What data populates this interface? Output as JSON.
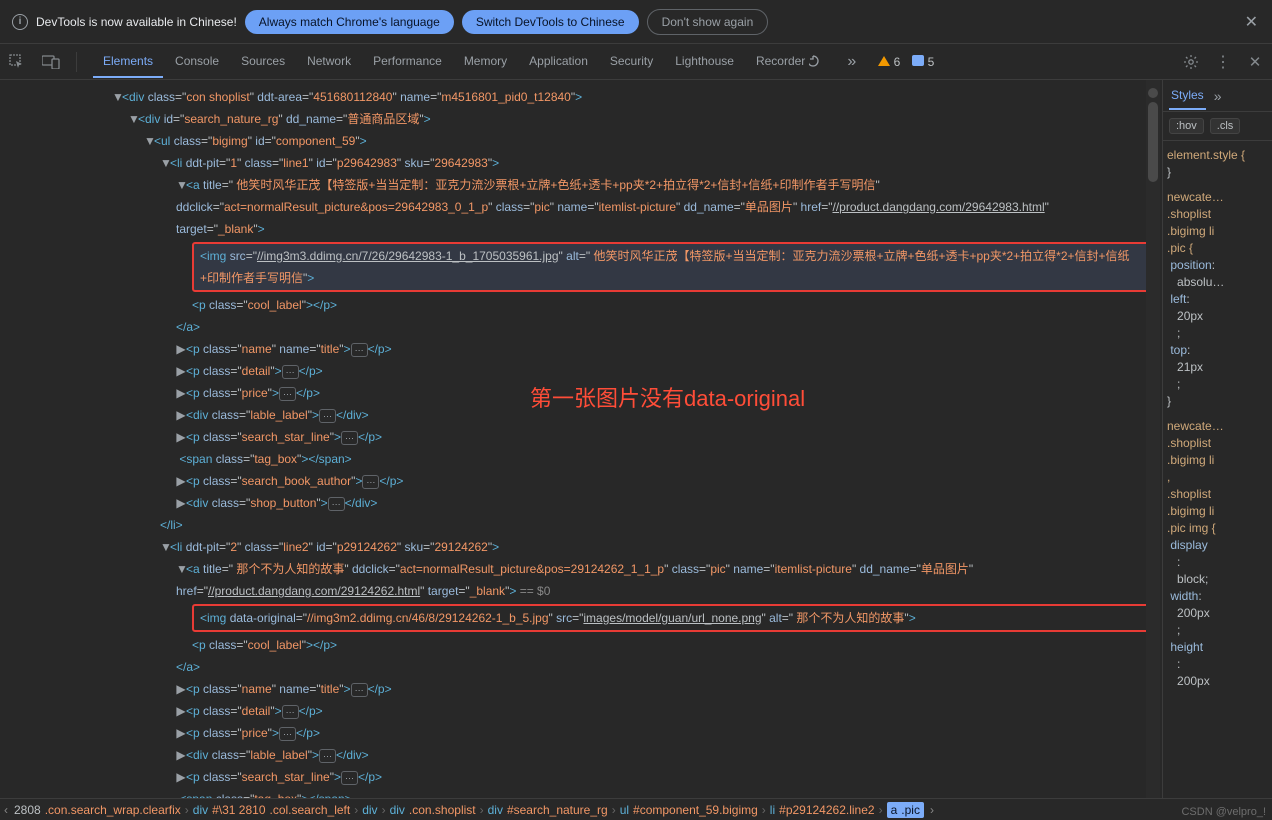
{
  "info_bar": {
    "text": "DevTools is now available in Chinese!",
    "btn1": "Always match Chrome's language",
    "btn2": "Switch DevTools to Chinese",
    "btn3": "Don't show again"
  },
  "tabs": [
    "Elements",
    "Console",
    "Sources",
    "Network",
    "Performance",
    "Memory",
    "Application",
    "Security",
    "Lighthouse",
    "Recorder"
  ],
  "issues": {
    "warnings": "6",
    "messages": "5"
  },
  "annotation": "第一张图片没有data-original",
  "dom": {
    "div_shoplist": {
      "class": "con shoplist",
      "ddt_area": "451680112840",
      "name": "m4516801_pid0_t12840"
    },
    "div_search": {
      "id": "search_nature_rg",
      "dd_name": "普通商品区域"
    },
    "ul": {
      "class": "bigimg",
      "id": "component_59"
    },
    "li1": {
      "ddt_pit": "1",
      "class": "line1",
      "id": "p29642983",
      "sku": "29642983"
    },
    "a1": {
      "title": " 他笑时风华正茂【特签版+当当定制：亚克力流沙票根+立牌+色纸+透卡+pp夹*2+拍立得*2+信封+信纸+印制作者手写明信",
      "ddclick": "act=normalResult_picture&pos=29642983_0_1_p",
      "class": "pic",
      "name": "itemlist-picture",
      "dd_name": "单品图片",
      "href": "//product.dangdang.com/29642983.html",
      "target": "_blank"
    },
    "img1": {
      "src": "//img3m3.ddimg.cn/7/26/29642983-1_b_1705035961.jpg",
      "alt": " 他笑时风华正茂【特签版+当当定制：亚克力流沙票根+立牌+色纸+透卡+pp夹*2+拍立得*2+信封+信纸+印制作者手写明信"
    },
    "cool": "cool_label",
    "pname": {
      "class": "name",
      "name": "title"
    },
    "detail": "detail",
    "price": "price",
    "lable": "lable_label",
    "star": "search_star_line",
    "tagbox": "tag_box",
    "author": "search_book_author",
    "shop": "shop_button",
    "li2": {
      "ddt_pit": "2",
      "class": "line2",
      "id": "p29124262",
      "sku": "29124262"
    },
    "a2": {
      "title": " 那个不为人知的故事",
      "ddclick": "act=normalResult_picture&pos=29124262_1_1_p",
      "class": "pic",
      "name": "itemlist-picture",
      "dd_name": "单品图片",
      "href": "//product.dangdang.com/29124262.html",
      "target": "_blank",
      "eq": "== $0"
    },
    "img2": {
      "data_original": "//img3m2.ddimg.cn/46/8/29124262-1_b_5.jpg",
      "src": "images/model/guan/url_none.png",
      "alt": " 那个不为人知的故事"
    }
  },
  "styles_panel": {
    "tab": "Styles",
    "hov": ":hov",
    "cls": ".cls",
    "r0": "element.style {",
    "r0b": "}",
    "r1": "newcate…",
    "r1a": ".shoplist",
    "r1b": ".bigimg li",
    "r1c": ".pic {",
    "p1": "position",
    "v1": "absolu…",
    "p2": "left",
    "v2": "20px",
    "p3": "top",
    "v3": "21px",
    "r1e": "}",
    "r2": "newcate…",
    "r2a": ".shoplist",
    "r2b": ".bigimg li",
    "r3": ".shoplist",
    "r3a": ".bigimg li",
    "r3b": ".pic img {",
    "p4": "display",
    "v4": "block;",
    "p5": "width",
    "v5": "200px",
    "p6": "height",
    "v6": "200px"
  },
  "bc": {
    "a": "2808",
    "b": ".con.search_wrap.clearfix",
    "c": "div",
    "d": "#\\31 2810",
    "e": ".col.search_left",
    "f": "div",
    "g": "div",
    "h": ".con.shoplist",
    "i": "div",
    "j": "#search_nature_rg",
    "k": "ul",
    "l": "#component_59.bigimg",
    "m": "li",
    "n": "#p29124262.line2",
    "o": "a",
    "p": ".pic"
  },
  "watermark": "CSDN @velpro_!"
}
